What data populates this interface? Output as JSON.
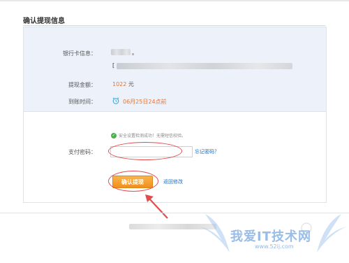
{
  "page": {
    "title": "确认提现信息"
  },
  "info": {
    "bank_label": "银行卡信息：",
    "bank_name_suffix": "。",
    "bank_account_prefix": "[",
    "amount_label": "提现金额：",
    "amount_value": "1022",
    "amount_unit": "元",
    "arrival_label": "到账时间：",
    "arrival_value": "06月25日24点前"
  },
  "form": {
    "security_notice": "安全设置检测成功！无需短信校验。",
    "password_label": "支付密码：",
    "password_value": "",
    "forgot_link": "忘记密码？",
    "confirm_button": "确认提现",
    "back_link": "返回修改"
  },
  "watermark": {
    "text": "我爱IT技术网",
    "url": "www.52ij.com"
  },
  "colors": {
    "accent_orange": "#f08f1c",
    "link_blue": "#1a6fc9",
    "annotation_red": "#e34c4c",
    "info_bg": "#edf2fa"
  },
  "icons": {
    "clock": "alarm-clock-icon",
    "check": "check-circle-icon",
    "arrow": "annotation-arrow-icon"
  }
}
